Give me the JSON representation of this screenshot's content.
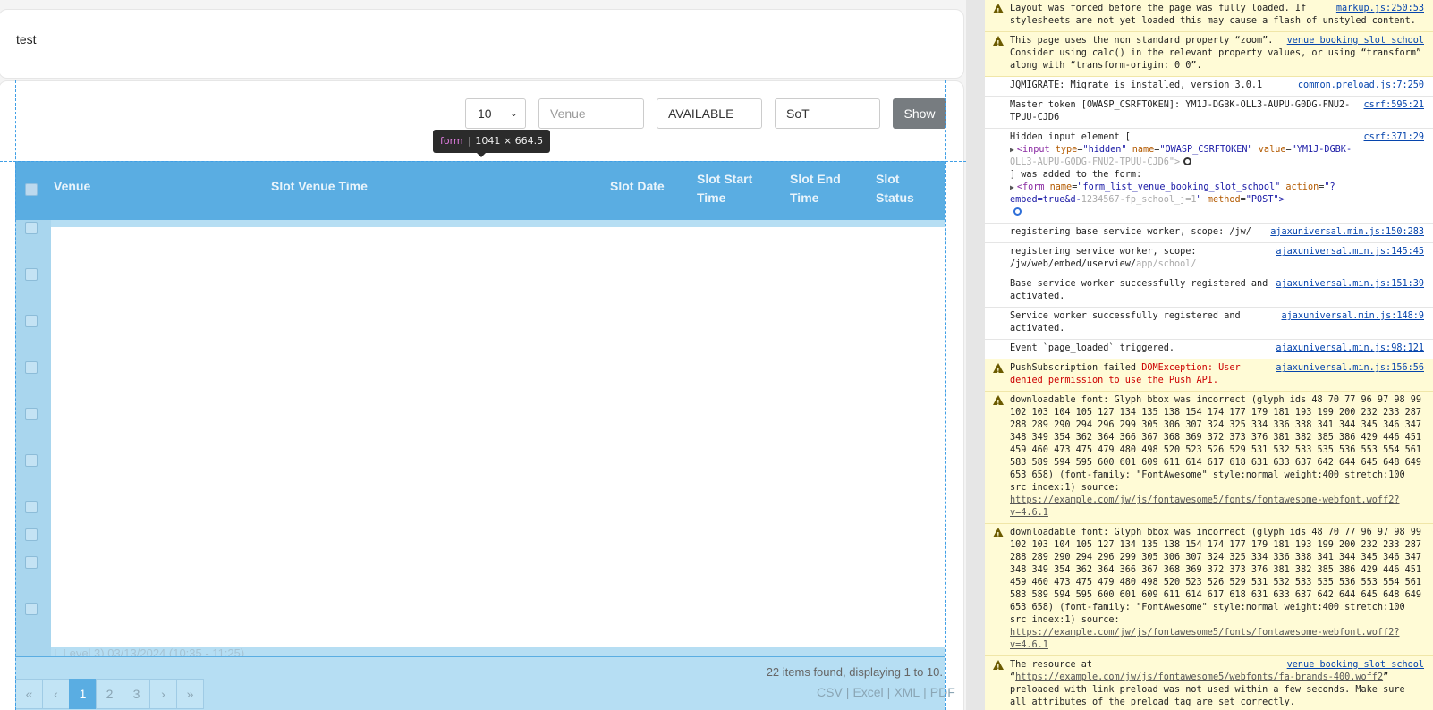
{
  "top_card": {
    "text": "test"
  },
  "filters": {
    "page_size": "10",
    "venue_placeholder": "Venue",
    "status_value": "AVAILABLE",
    "sot_value": "SoT",
    "show_label": "Show"
  },
  "tooltip": {
    "tag": "form",
    "dims": "1041 × 664.5"
  },
  "table": {
    "headers": [
      "Venue",
      "Slot Venue Time",
      "Slot Date",
      "Slot Start Time",
      "Slot End Time",
      "Slot Status"
    ],
    "row_count": 10,
    "blurred_row": "L Level 3)                                   03/13/2024 (10:35 - 11:25)"
  },
  "footer": {
    "found_text": "22 items found, displaying 1 to 10.",
    "pages": [
      "«",
      "‹",
      "1",
      "2",
      "3",
      "›",
      "»"
    ],
    "active_page": "1",
    "export": [
      "CSV",
      "Excel",
      "XML",
      "PDF"
    ]
  },
  "console": {
    "m1_text": "Layout was forced before the page was fully loaded. If stylesheets are not yet loaded this may cause a flash of unstyled content.",
    "m1_src": "markup.js:250:53",
    "m2_text": "This page uses the non standard property “zoom”. Consider using calc() in the relevant property values, or using “transform” along with “transform-origin: 0 0”.",
    "m2_src": "venue booking slot school",
    "m3_text": "JQMIGRATE: Migrate is installed, version 3.0.1",
    "m3_src": "common.preload.js:7:250",
    "m4_text": "Master token [OWASP_CSRFTOKEN]:  YM1J-DGBK-OLL3-AUPU-G0DG-FNU2-TPUU-CJD6",
    "m4_src": "csrf:595:21",
    "m5_src": "csrf:371:29",
    "m5_line1": "Hidden input element [",
    "m5_input_tag": "<input",
    "m5_a1": "type",
    "m5_v1": "\"hidden\"",
    "m5_a2": "name",
    "m5_v2": "\"OWASP_CSRFTOKEN\"",
    "m5_a3": "value",
    "m5_v3": "\"YM1J-DGBK-",
    "m5_line2_blur": "OLL3-AUPU-G0DG-FNU2-TPUU-CJD6\">",
    "m5_line3": "] was added to the form:",
    "m5_form_tag": "<form",
    "m5_fa1": "name",
    "m5_fv1": "\"form_list_venue_booking_slot_school\"",
    "m5_fa2": "action",
    "m5_fv2": "\"?",
    "m5_line5_a": "embed=true&d-",
    "m5_line5_blur": "1234567-fp_school_j=1",
    "m5_line5_b": "\"",
    "m5_fa3": "method",
    "m5_fv3": "\"POST\">",
    "m6_text": "registering base service worker, scope: /jw/",
    "m6_src": "ajaxuniversal.min.js:150:283",
    "m7_text": "registering service worker, scope: /jw/web/embed/userview/",
    "m7_blur": "app/school/",
    "m7_src": "ajaxuniversal.min.js:145:45",
    "m8_text": "Base service worker successfully registered and activated.",
    "m8_src": "ajaxuniversal.min.js:151:39",
    "m9_text": "Service worker successfully registered and activated.",
    "m9_src": "ajaxuniversal.min.js:148:9",
    "m10_text": "Event `page_loaded` triggered.",
    "m10_src": "ajaxuniversal.min.js:98:121",
    "m11_a": "PushSubscription failed",
    "m11_b": "DOMException: User denied permission to use the Push API.",
    "m11_src": "ajaxuniversal.min.js:156:56",
    "font_text": "downloadable font: Glyph bbox was incorrect (glyph ids 48 70 77 96 97 98 99 102 103 104 105 127 134 135 138 154 174 177 179 181 193 199 200 232 233 287 288 289 290 294 296 299 305 306 307 324 325 334 336 338 341 344 345 346 347 348 349 354 362 364 366 367 368 369 372 373 376 381 382 385 386 429 446 451 459 460 473 475 479 480 498 520 523 526 529 531 532 533 535 536 553 554 561 583 589 594 595 600 601 609 611 614 617 618 631 633 637 642 644 645 648 649 653 658) (font-family: \"FontAwesome\" style:normal weight:400 stretch:100 src index:1) source:",
    "m12_link": "https://example.com/jw/js/fontawesome5/fonts/fontawesome-webfont.woff2?v=4.6.1",
    "m13_link": "https://example.com/jw/js/fontawesome5/fonts/fontawesome-webfont.woff2?v=4.6.1",
    "m14_a": "The resource at “",
    "m14_link": "https://example.com/jw/js/fontawesome5/webfonts/fa-brands-400.woff2",
    "m14_b": "” preloaded with link preload was not used within a few seconds. Make sure all attributes of the preload tag are set correctly.",
    "m14_src": "venue booking slot school"
  }
}
